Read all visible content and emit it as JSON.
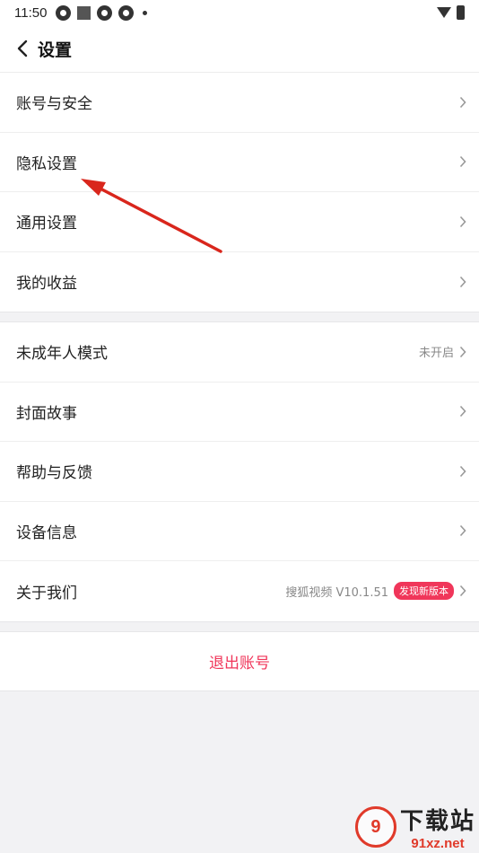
{
  "status_bar": {
    "time": "11:50"
  },
  "header": {
    "title": "设置"
  },
  "group1": [
    {
      "label": "账号与安全"
    },
    {
      "label": "隐私设置"
    },
    {
      "label": "通用设置"
    },
    {
      "label": "我的收益"
    }
  ],
  "group2": {
    "teen_mode": {
      "label": "未成年人模式",
      "value": "未开启"
    },
    "cover_story": {
      "label": "封面故事"
    },
    "help": {
      "label": "帮助与反馈"
    },
    "device_info": {
      "label": "设备信息"
    },
    "about": {
      "label": "关于我们",
      "value": "搜狐视频 V10.1.51",
      "badge": "发现新版本"
    }
  },
  "logout": {
    "label": "退出账号"
  },
  "annotation": {
    "color": "#d9261c"
  },
  "accent_color": "#f0365a",
  "watermark": {
    "logo": "9",
    "cn": "下载站",
    "url": "91xz.net"
  }
}
